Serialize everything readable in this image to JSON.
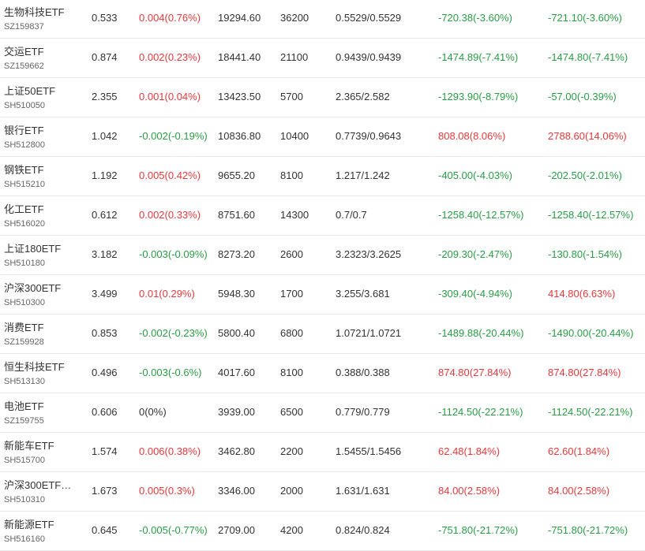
{
  "colors": {
    "up": "#e4393c",
    "down": "#2a9d45",
    "flat": "#333333",
    "text": "#333333",
    "subtext": "#666666",
    "divider": "#e8e8e8"
  },
  "rows": [
    {
      "name": "生物科技ETF",
      "code": "SZ159837",
      "price": "0.533",
      "change": "0.004(0.76%)",
      "change_dir": "up",
      "value": "19294.60",
      "shares": "36200",
      "cost": "0.5529/0.5529",
      "pnl": "-720.38(-3.60%)",
      "pnl_dir": "down",
      "total": "-721.10(-3.60%)",
      "total_dir": "down"
    },
    {
      "name": "交运ETF",
      "code": "SZ159662",
      "price": "0.874",
      "change": "0.002(0.23%)",
      "change_dir": "up",
      "value": "18441.40",
      "shares": "21100",
      "cost": "0.9439/0.9439",
      "pnl": "-1474.89(-7.41%)",
      "pnl_dir": "down",
      "total": "-1474.80(-7.41%)",
      "total_dir": "down"
    },
    {
      "name": "上证50ETF",
      "code": "SH510050",
      "price": "2.355",
      "change": "0.001(0.04%)",
      "change_dir": "up",
      "value": "13423.50",
      "shares": "5700",
      "cost": "2.365/2.582",
      "pnl": "-1293.90(-8.79%)",
      "pnl_dir": "down",
      "total": "-57.00(-0.39%)",
      "total_dir": "down"
    },
    {
      "name": "银行ETF",
      "code": "SH512800",
      "price": "1.042",
      "change": "-0.002(-0.19%)",
      "change_dir": "down",
      "value": "10836.80",
      "shares": "10400",
      "cost": "0.7739/0.9643",
      "pnl": "808.08(8.06%)",
      "pnl_dir": "up",
      "total": "2788.60(14.06%)",
      "total_dir": "up"
    },
    {
      "name": "钢铁ETF",
      "code": "SH515210",
      "price": "1.192",
      "change": "0.005(0.42%)",
      "change_dir": "up",
      "value": "9655.20",
      "shares": "8100",
      "cost": "1.217/1.242",
      "pnl": "-405.00(-4.03%)",
      "pnl_dir": "down",
      "total": "-202.50(-2.01%)",
      "total_dir": "down"
    },
    {
      "name": "化工ETF",
      "code": "SH516020",
      "price": "0.612",
      "change": "0.002(0.33%)",
      "change_dir": "up",
      "value": "8751.60",
      "shares": "14300",
      "cost": "0.7/0.7",
      "pnl": "-1258.40(-12.57%)",
      "pnl_dir": "down",
      "total": "-1258.40(-12.57%)",
      "total_dir": "down"
    },
    {
      "name": "上证180ETF",
      "code": "SH510180",
      "price": "3.182",
      "change": "-0.003(-0.09%)",
      "change_dir": "down",
      "value": "8273.20",
      "shares": "2600",
      "cost": "3.2323/3.2625",
      "pnl": "-209.30(-2.47%)",
      "pnl_dir": "down",
      "total": "-130.80(-1.54%)",
      "total_dir": "down"
    },
    {
      "name": "沪深300ETF",
      "code": "SH510300",
      "price": "3.499",
      "change": "0.01(0.29%)",
      "change_dir": "up",
      "value": "5948.30",
      "shares": "1700",
      "cost": "3.255/3.681",
      "pnl": "-309.40(-4.94%)",
      "pnl_dir": "down",
      "total": "414.80(6.63%)",
      "total_dir": "up"
    },
    {
      "name": "消费ETF",
      "code": "SZ159928",
      "price": "0.853",
      "change": "-0.002(-0.23%)",
      "change_dir": "down",
      "value": "5800.40",
      "shares": "6800",
      "cost": "1.0721/1.0721",
      "pnl": "-1489.88(-20.44%)",
      "pnl_dir": "down",
      "total": "-1490.00(-20.44%)",
      "total_dir": "down"
    },
    {
      "name": "恒生科技ETF",
      "code": "SH513130",
      "price": "0.496",
      "change": "-0.003(-0.6%)",
      "change_dir": "down",
      "value": "4017.60",
      "shares": "8100",
      "cost": "0.388/0.388",
      "pnl": "874.80(27.84%)",
      "pnl_dir": "up",
      "total": "874.80(27.84%)",
      "total_dir": "up"
    },
    {
      "name": "电池ETF",
      "code": "SZ159755",
      "price": "0.606",
      "change": "0(0%)",
      "change_dir": "flat",
      "value": "3939.00",
      "shares": "6500",
      "cost": "0.779/0.779",
      "pnl": "-1124.50(-22.21%)",
      "pnl_dir": "down",
      "total": "-1124.50(-22.21%)",
      "total_dir": "down"
    },
    {
      "name": "新能车ETF",
      "code": "SH515700",
      "price": "1.574",
      "change": "0.006(0.38%)",
      "change_dir": "up",
      "value": "3462.80",
      "shares": "2200",
      "cost": "1.5455/1.5456",
      "pnl": "62.48(1.84%)",
      "pnl_dir": "up",
      "total": "62.60(1.84%)",
      "total_dir": "up"
    },
    {
      "name": "沪深300ETF…",
      "code": "SH510310",
      "price": "1.673",
      "change": "0.005(0.3%)",
      "change_dir": "up",
      "value": "3346.00",
      "shares": "2000",
      "cost": "1.631/1.631",
      "pnl": "84.00(2.58%)",
      "pnl_dir": "up",
      "total": "84.00(2.58%)",
      "total_dir": "up"
    },
    {
      "name": "新能源ETF",
      "code": "SH516160",
      "price": "0.645",
      "change": "-0.005(-0.77%)",
      "change_dir": "down",
      "value": "2709.00",
      "shares": "4200",
      "cost": "0.824/0.824",
      "pnl": "-751.80(-21.72%)",
      "pnl_dir": "down",
      "total": "-751.80(-21.72%)",
      "total_dir": "down"
    }
  ]
}
